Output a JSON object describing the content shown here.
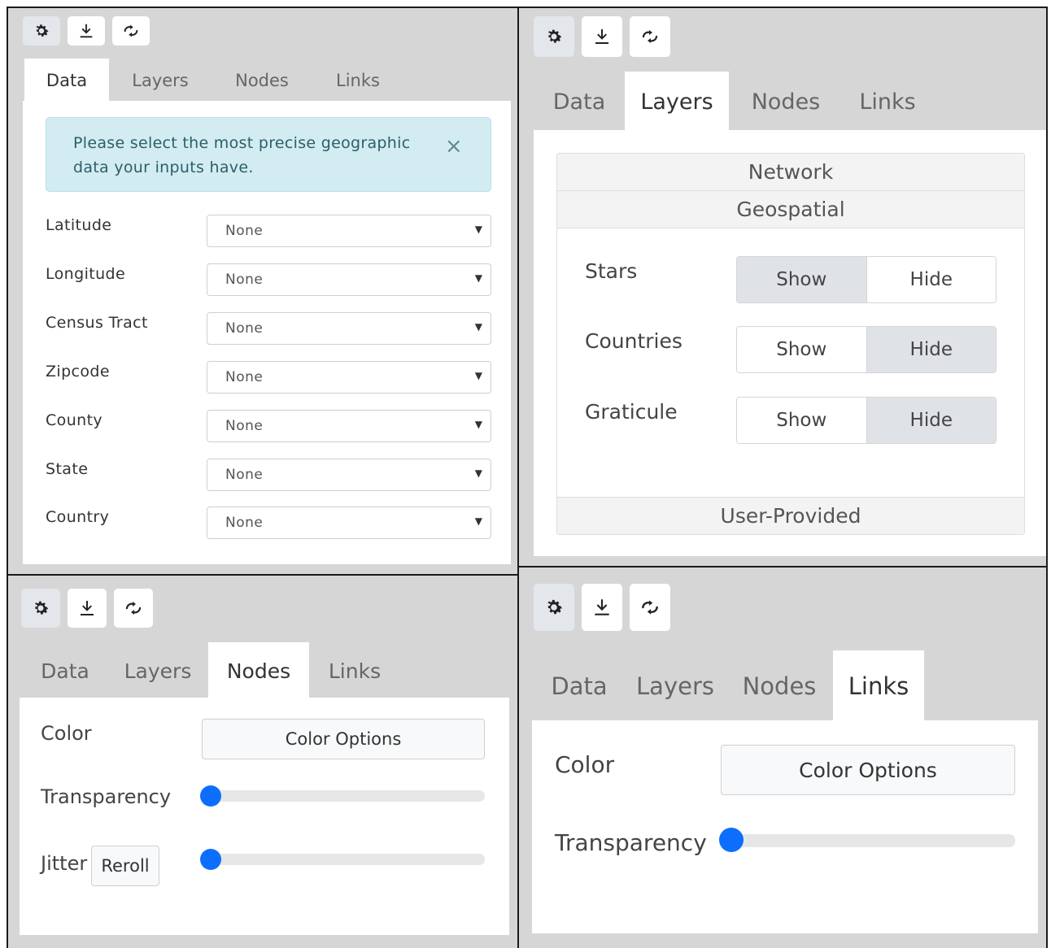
{
  "toolbar": {
    "settings_icon": "gear-icon",
    "download_icon": "download-icon",
    "refresh_icon": "refresh-arrows-icon"
  },
  "tabs": [
    "Data",
    "Layers",
    "Nodes",
    "Links"
  ],
  "data_panel": {
    "alert_text": "Please select the most precise geographic data your inputs have.",
    "alert_close": "×",
    "fields": [
      {
        "label": "Latitude",
        "value": "None"
      },
      {
        "label": "Longitude",
        "value": "None"
      },
      {
        "label": "Census Tract",
        "value": "None"
      },
      {
        "label": "Zipcode",
        "value": "None"
      },
      {
        "label": "County",
        "value": "None"
      },
      {
        "label": "State",
        "value": "None"
      },
      {
        "label": "Country",
        "value": "None"
      }
    ]
  },
  "layers_panel": {
    "sections": [
      "Network",
      "Geospatial",
      "User-Provided"
    ],
    "toggles": [
      {
        "label": "Stars",
        "show": "Show",
        "hide": "Hide",
        "selected": "Show"
      },
      {
        "label": "Countries",
        "show": "Show",
        "hide": "Hide",
        "selected": "Hide"
      },
      {
        "label": "Graticule",
        "show": "Show",
        "hide": "Hide",
        "selected": "Hide"
      }
    ]
  },
  "nodes_panel": {
    "color_label": "Color",
    "color_button": "Color Options",
    "transparency_label": "Transparency",
    "transparency_value": 0,
    "jitter_label": "Jitter",
    "reroll_button": "Reroll",
    "jitter_value": 0
  },
  "links_panel": {
    "color_label": "Color",
    "color_button": "Color Options",
    "transparency_label": "Transparency",
    "transparency_value": 0
  },
  "colors": {
    "accent": "#0d6efd",
    "alert_bg": "#d2ecf1",
    "frame_bg": "#d6d6d6"
  }
}
